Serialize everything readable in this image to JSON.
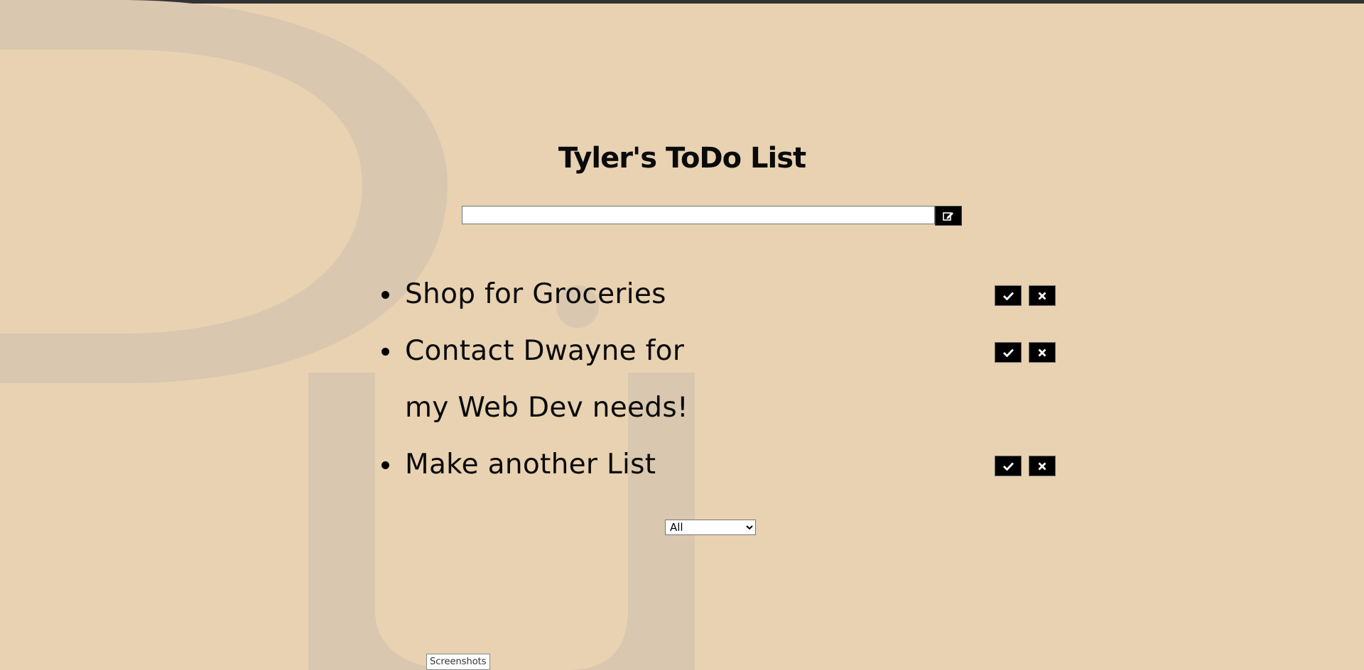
{
  "app": {
    "title": "Tyler's ToDo List",
    "input_value": ""
  },
  "todos": [
    {
      "text": "Shop for Groceries"
    },
    {
      "text": "Contact Dwayne for my Web Dev needs!"
    },
    {
      "text": "Make another List"
    }
  ],
  "filter": {
    "selected": "All"
  },
  "tooltip": "Screenshots",
  "icons": {
    "add": "edit-icon",
    "complete": "check-icon",
    "delete": "close-icon"
  },
  "colors": {
    "background": "#e8d2b2",
    "button": "#000000"
  }
}
